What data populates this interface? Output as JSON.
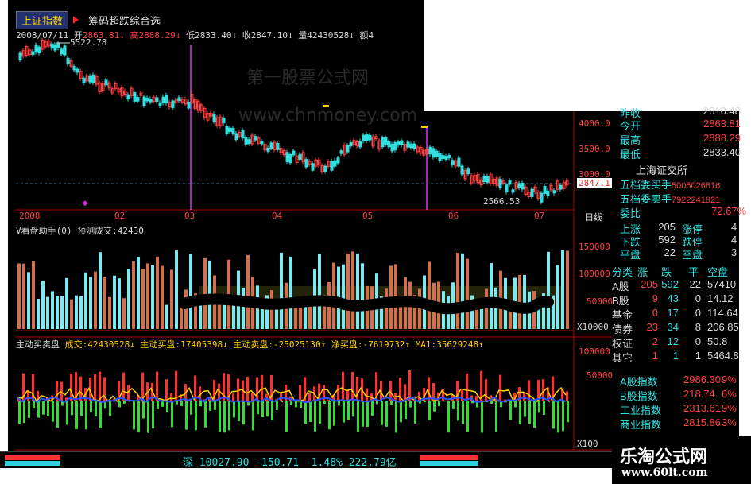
{
  "header": {
    "tab_index": "上证指数",
    "tab_formula": "筹码超跌综合选"
  },
  "quote_line": {
    "date": "2008/07/11",
    "open_label": "开",
    "open": "2863.81",
    "high_label": "高",
    "high": "2888.29",
    "low_label": "低",
    "low": "2833.40",
    "close_label": "收",
    "close": "2847.10",
    "vol_label": "量",
    "vol": "42430528",
    "amt_label": "额",
    "amt": "4"
  },
  "main_chart": {
    "high_marker": "5522.78",
    "low_marker": "2566.53",
    "current_price": "2847.1",
    "y_ticks": [
      "4000.0",
      "3500.0",
      "3000.0"
    ],
    "x_ticks": [
      "2008",
      "02",
      "03",
      "04",
      "05",
      "06",
      "07"
    ],
    "period": "日线",
    "watermark1": "第一股票公式网",
    "watermark2": "www.chnmoney.com"
  },
  "volume_panel": {
    "title": "V看盘助手(0)",
    "predict_label": "预测成交:",
    "predict_value": "42430",
    "y_ticks": [
      "150000",
      "100000",
      "50000"
    ],
    "unit": "X10000"
  },
  "flow_panel": {
    "title": "主动买卖盘",
    "vol_label": "成交:",
    "vol": "42430528",
    "buy_label": "主动买盘:",
    "buy": "17405398",
    "sell_label": "主动卖盘:",
    "sell": "-25025130",
    "net_label": "净买盘:",
    "net": "-7619732",
    "ma_label": "MA1:",
    "ma": "35629248",
    "y_ticks": [
      "100000",
      "50000"
    ],
    "unit": "X100"
  },
  "side_quote": {
    "rows": [
      {
        "label": "昨收",
        "value": "2810.48"
      },
      {
        "label": "今开",
        "value": "2863.81"
      },
      {
        "label": "最高",
        "value": "2888.29"
      },
      {
        "label": "最低",
        "value": "2833.40"
      }
    ],
    "exchange": "上海证交所",
    "bid_label": "五档委买手",
    "bid": "5005026816",
    "ask_label": "五档委卖手",
    "ask": "7922241921",
    "ratio_label": "委比",
    "ratio": "72.67%",
    "breadth": [
      {
        "a": "上涨",
        "b": "205",
        "c": "涨停",
        "d": "4"
      },
      {
        "a": "下跌",
        "b": "592",
        "c": "跌停",
        "d": "4"
      },
      {
        "a": "平盘",
        "b": "22",
        "c": "空盘",
        "d": "3"
      }
    ],
    "cat_header": [
      "分类",
      "涨",
      "跌",
      "平",
      "空盘"
    ],
    "cats": [
      {
        "name": "A股",
        "up": "205",
        "dn": "592",
        "flat": "22",
        "amt": "57410"
      },
      {
        "name": "B股",
        "up": "9",
        "dn": "43",
        "flat": "0",
        "amt": "14.12"
      },
      {
        "name": "基金",
        "up": "0",
        "dn": "17",
        "flat": "0",
        "amt": "114.64"
      },
      {
        "name": "债券",
        "up": "23",
        "dn": "34",
        "flat": "8",
        "amt": "206.85"
      },
      {
        "name": "权证",
        "up": "2",
        "dn": "12",
        "flat": "0",
        "amt": "50.8"
      },
      {
        "name": "其它",
        "up": "1",
        "dn": "1",
        "flat": "1",
        "amt": "5464.8"
      }
    ],
    "indices": [
      {
        "name": "A股指数",
        "value": "2986.30",
        "pct": "9%"
      },
      {
        "name": "B股指数",
        "value": "218.74",
        "pct": "6%"
      },
      {
        "name": "工业指数",
        "value": "2313.61",
        "pct": "9%"
      },
      {
        "name": "商业指数",
        "value": "2815.86",
        "pct": "3%"
      }
    ]
  },
  "bottom_bar": {
    "market": "深",
    "index": "10027.90",
    "change": "-150.71",
    "pct": "-1.48%",
    "amount": "222.79亿"
  },
  "logo": {
    "title": "乐淘公式网",
    "url": "www.60lt.com"
  },
  "colors": {
    "up": "#ff4040",
    "down": "#30e0e0",
    "grid": "#b00000",
    "ma": "#ffd000",
    "netline": "#3050ff"
  }
}
